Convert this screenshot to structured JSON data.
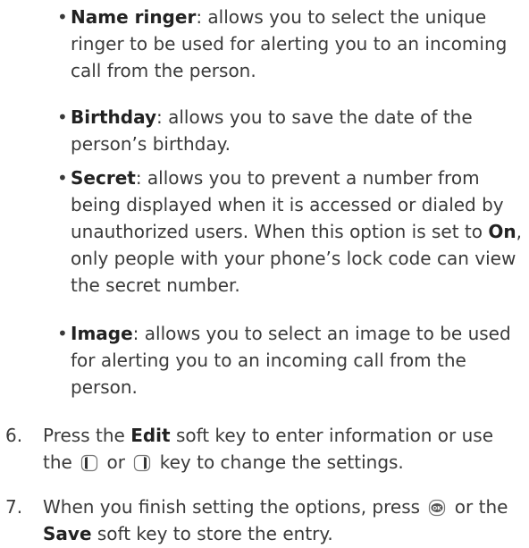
{
  "bullets": [
    {
      "term": "Name ringer",
      "rest": ": allows you to select the unique ringer to be used for alerting you to an incoming call from the person."
    },
    {
      "term": "Birthday",
      "rest": ": allows you to save the date of the person’s birthday."
    },
    {
      "term": "Secret",
      "rest_a": ": allows you to prevent a number from being displayed when it is accessed or dialed by unauthorized users. When this option is set to ",
      "on": "On",
      "rest_b": ", only people with your phone’s lock code can view the secret number."
    },
    {
      "term": "Image",
      "rest": ": allows you to select an image to be used for alerting you to an incoming call from the person."
    }
  ],
  "bullet_symbol": "•",
  "steps": {
    "six": {
      "num": "6.",
      "a": "Press the ",
      "edit": "Edit",
      "b": " soft key to enter information or use the ",
      "c": " or ",
      "d": " key to change the settings.",
      "icon_left": "left-nav-key-icon",
      "icon_right": "right-nav-key-icon"
    },
    "seven": {
      "num": "7.",
      "a": "When you finish setting the options, press ",
      "b": " or the ",
      "save": "Save",
      "c": " soft key to store the entry.",
      "icon_ok": "ok-key-icon",
      "ok_label": "OK"
    }
  }
}
